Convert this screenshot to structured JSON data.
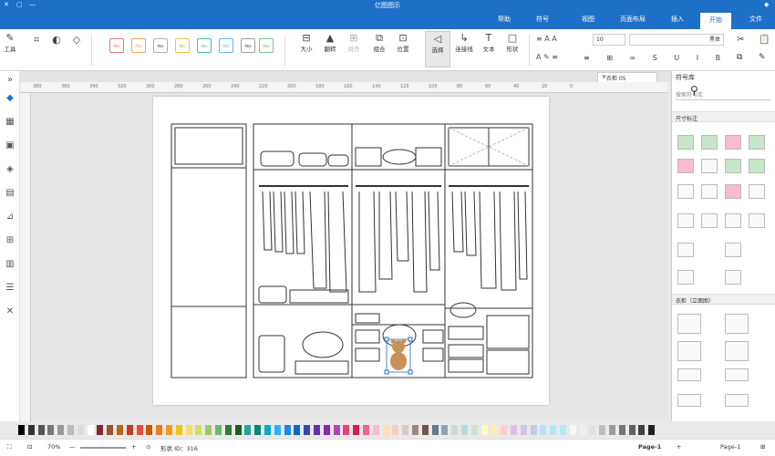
{
  "window": {
    "title": "亿图图示"
  },
  "menu": {
    "file": "文件",
    "start": "开始",
    "insert": "插入",
    "page_layout": "页面布局",
    "view": "视图",
    "symbol": "符号",
    "help": "帮助"
  },
  "ribbon": {
    "font_name": "黑体",
    "font_size": "10",
    "style_sample": "Abc",
    "tools": {
      "select": "选择",
      "connector": "连接线",
      "text": "文本",
      "shape": "形状",
      "position": "位置",
      "combine": "组合",
      "align": "对齐",
      "rotate": "翻转",
      "size": "大小",
      "tools_label": "工具"
    }
  },
  "tabs": {
    "doc_tab": "衣柜 05"
  },
  "ruler_ticks": [
    "380",
    "360",
    "340",
    "320",
    "300",
    "280",
    "260",
    "240",
    "220",
    "200",
    "180",
    "160",
    "140",
    "120",
    "100",
    "80",
    "60",
    "40",
    "20",
    "0"
  ],
  "right_panel": {
    "title": "符号库",
    "search_placeholder": "搜索符号库",
    "section1": "尺寸标注",
    "section2": "衣柜（立面图）"
  },
  "status": {
    "page_dropdown": "Page-1",
    "page_tab": "Page-1",
    "shape_id": "形状 ID：316",
    "zoom": "70%"
  },
  "colors": {
    "title_blue": "#1e6fc8",
    "accent_red": "#c0392b",
    "accent_green": "#5cb85c",
    "bear_brown": "#c8915a"
  },
  "palette": [
    "#000000",
    "#333333",
    "#555555",
    "#777777",
    "#999999",
    "#bbbbbb",
    "#dddddd",
    "#ffffff",
    "#7f2a2a",
    "#a0522d",
    "#b5651d",
    "#c0392b",
    "#e74c3c",
    "#d35400",
    "#e67e22",
    "#f39c12",
    "#f1c40f",
    "#f7dc6f",
    "#d4e157",
    "#9ccc65",
    "#66bb6a",
    "#2e7d32",
    "#1b5e20",
    "#26a69a",
    "#00897b",
    "#00acc1",
    "#29b6f6",
    "#1e88e5",
    "#1565c0",
    "#3949ab",
    "#5e35b1",
    "#8e24aa",
    "#ab47bc",
    "#ec407a",
    "#d81b60",
    "#f06292",
    "#f8bbd0",
    "#ffe0b2",
    "#ffccbc",
    "#d7ccc8",
    "#a1887f",
    "#795548",
    "#607d8b",
    "#90a4ae",
    "#cfd8dc",
    "#b2dfdb",
    "#c8e6c9",
    "#fff9c4",
    "#ffecb3",
    "#ffcdd2",
    "#e1bee7",
    "#d1c4e9",
    "#c5cae9",
    "#bbdefb",
    "#b3e5fc",
    "#b2ebf2",
    "#f5f5f5",
    "#eeeeee",
    "#e0e0e0",
    "#bdbdbd",
    "#9e9e9e",
    "#757575",
    "#616161",
    "#424242",
    "#212121"
  ]
}
